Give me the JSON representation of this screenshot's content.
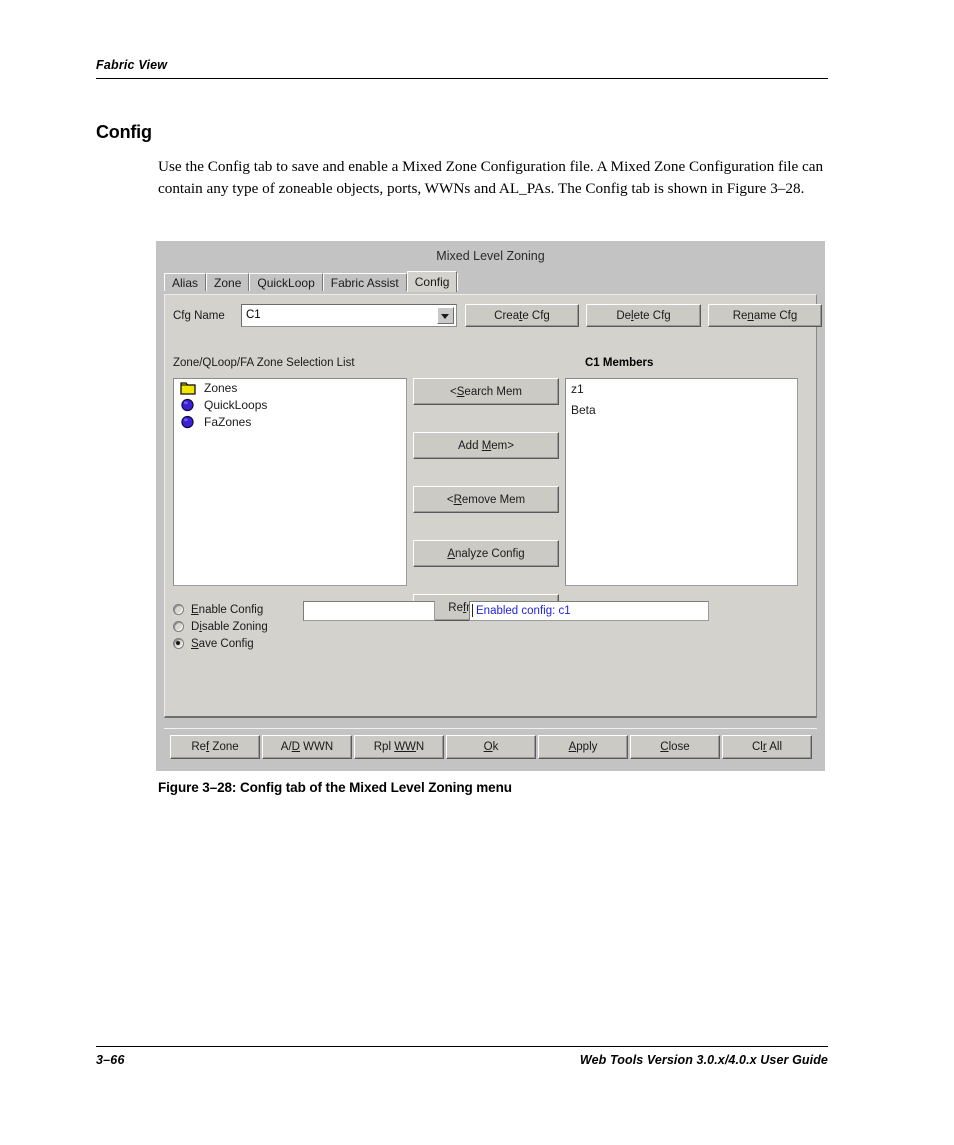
{
  "page": {
    "running_head": "Fabric View",
    "section_heading": "Config",
    "body_paragraph": "Use the Config tab to save and enable a Mixed Zone Configuration file. A Mixed Zone Configuration file can contain any type of zoneable objects, ports, WWNs and AL_PAs. The Config tab is shown in Figure 3–28.",
    "figure_caption": "Figure 3–28:  Config tab of the Mixed Level Zoning menu",
    "footer_page_number": "3–66",
    "footer_guide": "Web Tools Version 3.0.x/4.0.x User Guide"
  },
  "dialog": {
    "title": "Mixed Level Zoning",
    "tabs": [
      {
        "label": "Alias",
        "active": false
      },
      {
        "label": "Zone",
        "active": false
      },
      {
        "label": "QuickLoop",
        "active": false
      },
      {
        "label": "Fabric Assist",
        "active": false
      },
      {
        "label": "Config",
        "active": true
      }
    ],
    "cfg_row": {
      "label": "Cfg Name",
      "combo_value": "C1",
      "buttons": [
        {
          "label": "Create Cfg",
          "mnemonic": "t"
        },
        {
          "label": "Delete Cfg",
          "mnemonic": "l"
        },
        {
          "label": "Rename Cfg",
          "mnemonic": "n"
        }
      ]
    },
    "left_panel": {
      "label": "Zone/QLoop/FA Zone Selection List",
      "items": [
        {
          "label": "Zones",
          "icon": "folder-icon",
          "color": "#f2e500"
        },
        {
          "label": "QuickLoops",
          "icon": "sphere-icon",
          "color": "#3b20d6"
        },
        {
          "label": "FaZones",
          "icon": "sphere-icon",
          "color": "#3b20d6"
        }
      ]
    },
    "middle_buttons": [
      {
        "label": "<Search Mem",
        "mnemonic": "S"
      },
      {
        "label": "Add Mem>",
        "mnemonic": "M"
      },
      {
        "label": "<Remove Mem",
        "mnemonic": "R"
      },
      {
        "label": "Analyze Config",
        "mnemonic": "A"
      },
      {
        "label": "Refresh Fabric",
        "mnemonic": "f"
      }
    ],
    "right_panel": {
      "label": "C1 Members",
      "items": [
        "z1",
        "Beta"
      ]
    },
    "radio_options": [
      {
        "label": "Enable Config",
        "mnemonic": "E",
        "selected": false
      },
      {
        "label": "Disable Zoning",
        "mnemonic": "i",
        "selected": false
      },
      {
        "label": "Save Config",
        "mnemonic": "S",
        "selected": true
      }
    ],
    "name_input_value": "",
    "status_field": {
      "text": "Enabled config: c1",
      "color": "#2222dd"
    },
    "bottom_buttons": [
      {
        "label": "Ref Zone",
        "mnemonic": "f"
      },
      {
        "label": "A/D WWN",
        "mnemonic": "D"
      },
      {
        "label": "Rpl WWN",
        "mnemonic": "WW"
      },
      {
        "label": "Ok",
        "mnemonic": "O"
      },
      {
        "label": "Apply",
        "mnemonic": "A"
      },
      {
        "label": "Close",
        "mnemonic": "C"
      },
      {
        "label": "Clr All",
        "mnemonic": "r"
      }
    ]
  }
}
